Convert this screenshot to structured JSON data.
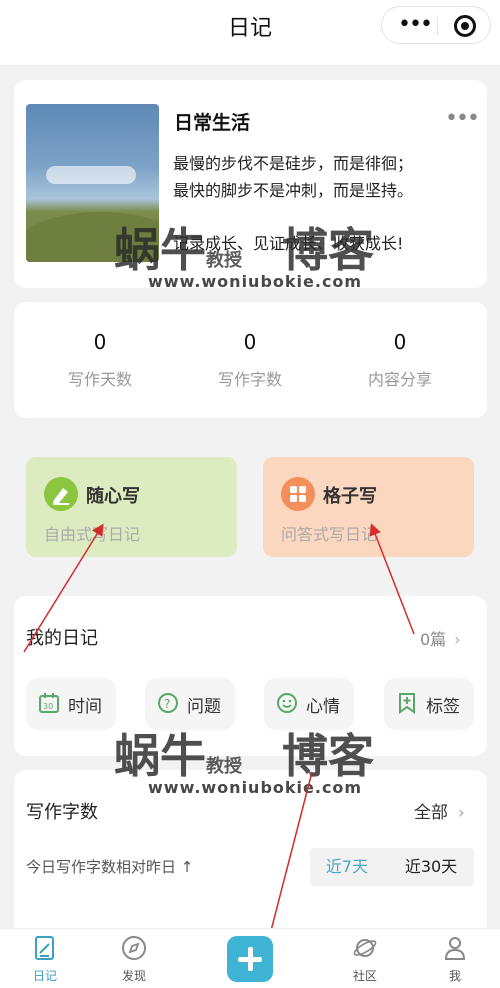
{
  "header": {
    "title": "日记"
  },
  "diary": {
    "title": "日常生活",
    "lines": [
      "最慢的步伐不是硅步，而是徘徊；",
      "最快的脚步不是冲刺，而是坚持。",
      "记录成长、见证成长、收获成长!"
    ],
    "more": "•••"
  },
  "stats": [
    {
      "value": "0",
      "label": "写作天数"
    },
    {
      "value": "0",
      "label": "写作字数"
    },
    {
      "value": "0",
      "label": "内容分享"
    }
  ],
  "write_modes": [
    {
      "title": "随心写",
      "subtitle": "自由式写日记",
      "icon": "pen-icon"
    },
    {
      "title": "格子写",
      "subtitle": "问答式写日记",
      "icon": "grid-icon"
    }
  ],
  "my_diary": {
    "title": "我的日记",
    "count": "0篇",
    "chips": [
      {
        "label": "时间",
        "icon": "calendar-icon"
      },
      {
        "label": "问题",
        "icon": "question-icon"
      },
      {
        "label": "心情",
        "icon": "smile-icon"
      },
      {
        "label": "标签",
        "icon": "tag-icon"
      }
    ]
  },
  "word_count": {
    "title": "写作字数",
    "filter": "全部",
    "compare": "今日写作字数相对昨日 ↑",
    "seg_7": "近7天",
    "seg_30": "近30天"
  },
  "tabs": [
    {
      "label": "日记",
      "icon": "diary-icon"
    },
    {
      "label": "发现",
      "icon": "compass-icon"
    },
    {
      "label": "社区",
      "icon": "planet-icon"
    },
    {
      "label": "我",
      "icon": "user-icon"
    }
  ],
  "watermark": {
    "brand_a": "蜗牛",
    "brand_b": "教授",
    "brand_c": "博客",
    "url": "www.woniubokie.com"
  },
  "colors": {
    "accent": "#3fb3d3",
    "green_card": "#dcebc0",
    "orange_card": "#fcd7bf"
  }
}
